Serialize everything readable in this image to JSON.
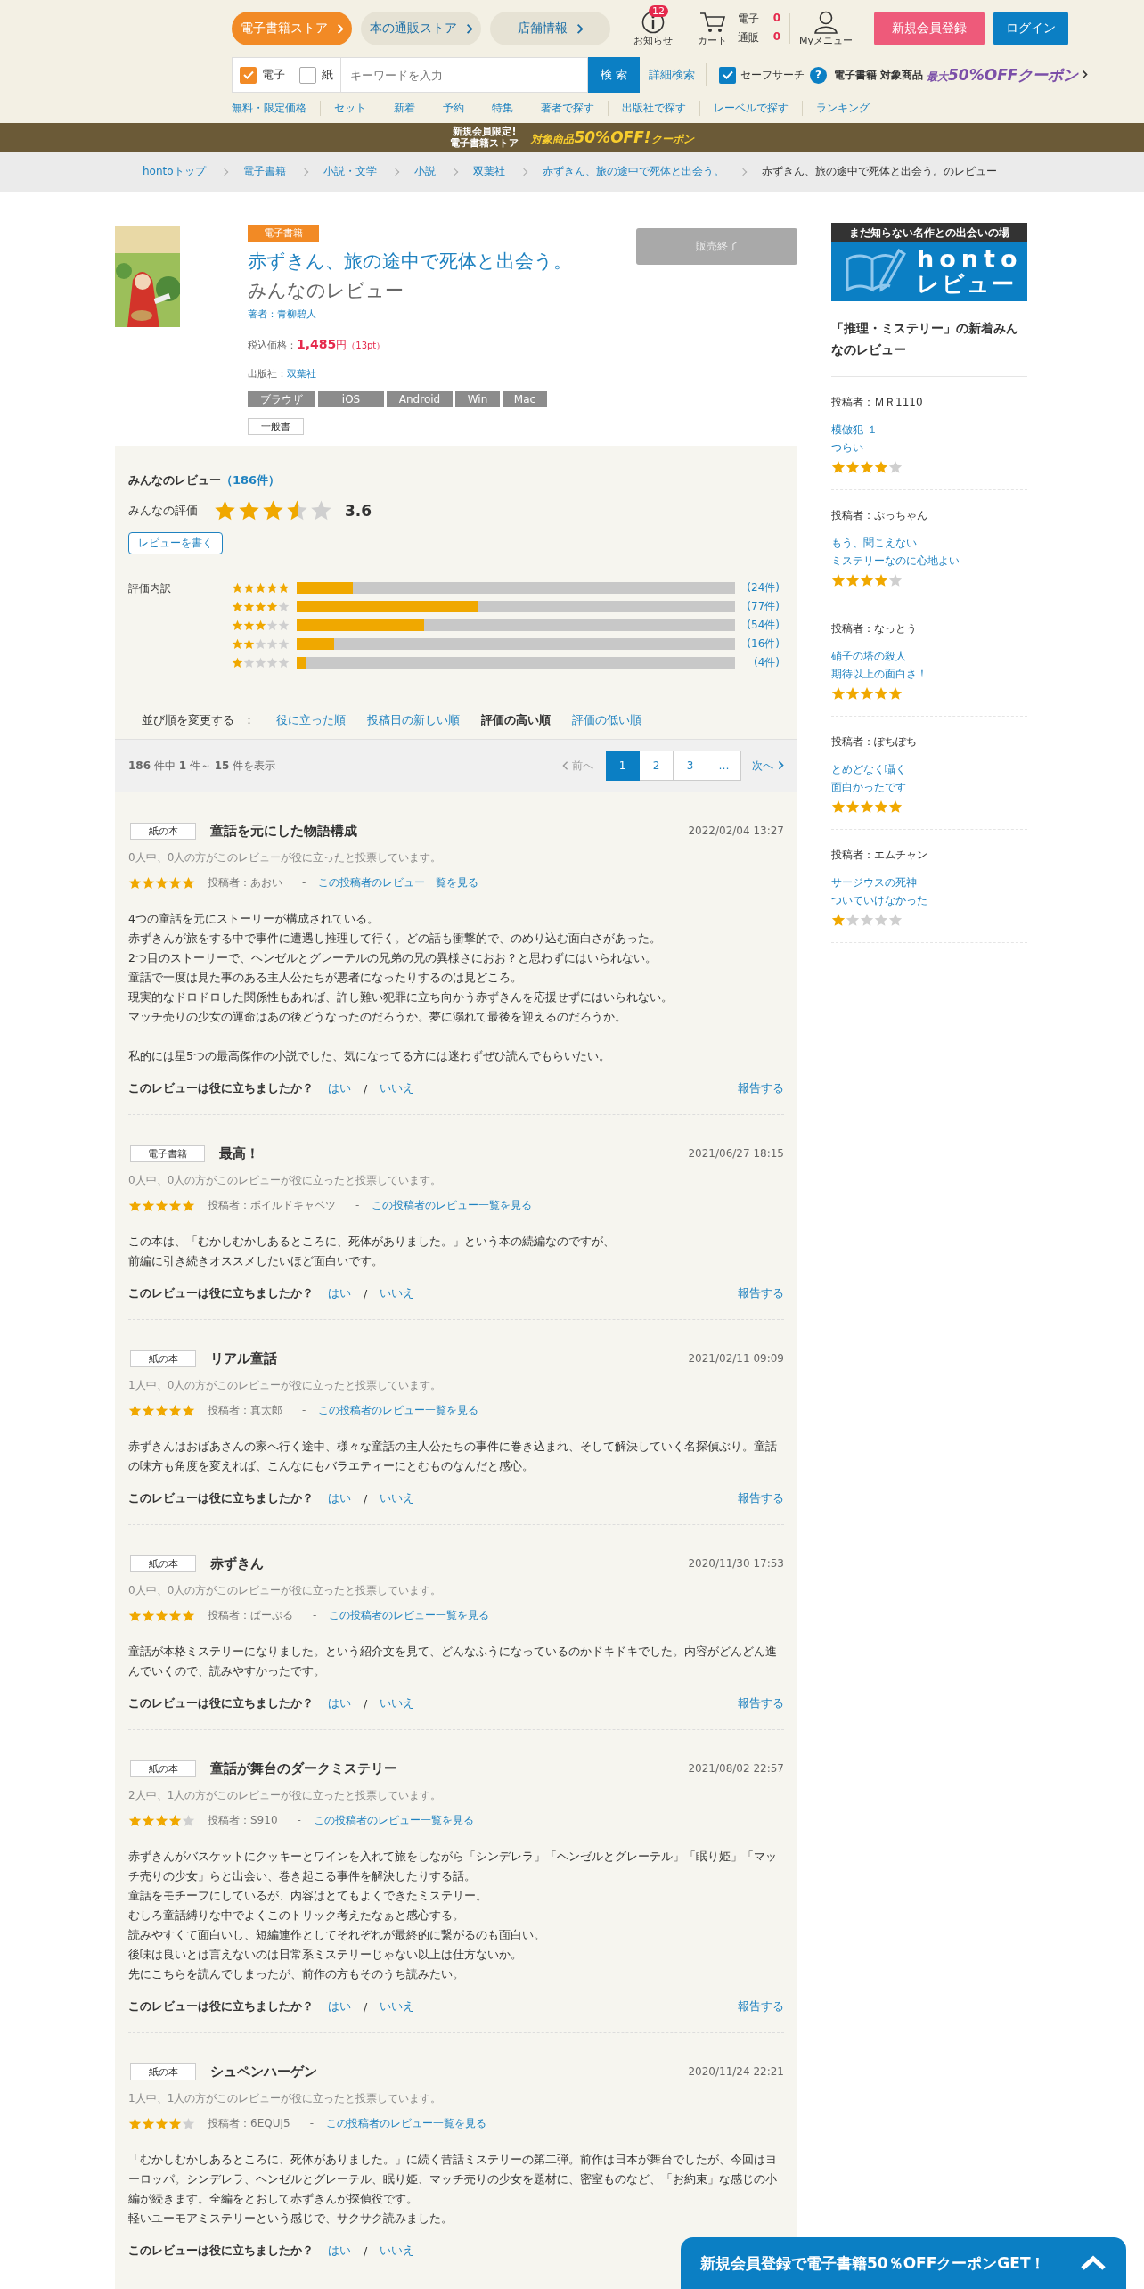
{
  "header": {
    "store_tabs": [
      {
        "label": "電子書籍ストア",
        "selected": true
      },
      {
        "label": "本の通販ストア",
        "selected": false
      },
      {
        "label": "店舗情報",
        "selected": false
      }
    ],
    "notifications": {
      "label": "お知らせ",
      "count": "12"
    },
    "cart": {
      "label": "カート",
      "rows": [
        {
          "label": "電子",
          "count": "0"
        },
        {
          "label": "通販",
          "count": "0"
        }
      ]
    },
    "my_menu": {
      "label": "Myメニュー"
    },
    "register_button": "新規会員登録",
    "login_button": "ログイン",
    "search": {
      "checkboxes": [
        {
          "label": "電子",
          "checked": true
        },
        {
          "label": "紙",
          "checked": false
        }
      ],
      "placeholder": "キーワードを入力",
      "button": "検 索",
      "advanced_link": "詳細検索",
      "safe_search": {
        "label": "セーフサーチ",
        "checked": true
      },
      "help": "?"
    },
    "coupon": {
      "prefix": "電子書籍",
      "middle": "対象商品",
      "offer": "最大**50%OFFクーポン**"
    },
    "nav_links": [
      "無料・限定価格",
      "セット",
      "新着",
      "予約",
      "特集",
      "著者で探す",
      "出版社で探す",
      "レーベルで探す",
      "ランキング"
    ]
  },
  "promo_banner": {
    "line1": "新規会員限定!",
    "line2": "電子書籍ストア",
    "offer": "対象商品**50%OFF!**クーポン"
  },
  "breadcrumb": [
    {
      "label": "hontoトップ",
      "current": false
    },
    {
      "label": "電子書籍",
      "current": false
    },
    {
      "label": "小説・文学",
      "current": false
    },
    {
      "label": "小説",
      "current": false
    },
    {
      "label": "双葉社",
      "current": false
    },
    {
      "label": "赤ずきん、旅の途中で死体と出会う。",
      "current": false
    },
    {
      "label": "赤ずきん、旅の途中で死体と出会う。のレビュー",
      "current": true
    }
  ],
  "product": {
    "format_badge": "電子書籍",
    "title": "赤ずきん、旅の途中で死体と出会う。",
    "title_suffix": "みんなのレビュー",
    "author": "著者：青柳碧人",
    "price_label": "税込価格：",
    "price": "1,485",
    "currency": "円",
    "points": "（13pt）",
    "publisher_label": "出版社：",
    "publisher": "双葉社",
    "platforms": [
      "ブラウザ",
      "iOS",
      "Android",
      "Win",
      "Mac"
    ],
    "genre": "一般書",
    "sold_out_button": {
      "label": "販売終了",
      "disabled": true
    }
  },
  "rating_summary": {
    "heading": "みんなのレビュー",
    "count": "（186件）",
    "average_label": "みんなの評価",
    "stars": 3.5,
    "score": "3.6",
    "write_button": "レビューを書く",
    "breakdown_label": "評価内訳",
    "breakdown": [
      {
        "stars": 5,
        "level": 0.129,
        "count": "(24件)"
      },
      {
        "stars": 4,
        "level": 0.414,
        "count": "(77件)"
      },
      {
        "stars": 3,
        "level": 0.29,
        "count": "(54件)"
      },
      {
        "stars": 2,
        "level": 0.086,
        "count": "(16件)"
      },
      {
        "stars": 1,
        "level": 0.022,
        "count": "(4件)"
      }
    ]
  },
  "sort": {
    "label": "並び順を変更する",
    "separator": "：",
    "options": [
      {
        "label": "役に立った順",
        "selected": false
      },
      {
        "label": "投稿日の新しい順",
        "selected": false
      },
      {
        "label": "評価の高い順",
        "selected": true
      },
      {
        "label": "評価の低い順",
        "selected": false
      }
    ]
  },
  "pagination": {
    "summary": "**186** 件中 **1** 件～ **15** 件を表示",
    "prev": "前へ",
    "pages": [
      {
        "label": "1",
        "selected": true
      },
      {
        "label": "2",
        "selected": false
      },
      {
        "label": "3",
        "selected": false
      },
      {
        "label": "…",
        "selected": false
      }
    ],
    "next": "次へ"
  },
  "reviews": [
    {
      "format": "紙の本",
      "title": "童話を元にした物語構成",
      "date": "2022/02/04 13:27",
      "votes": "0人中、0人の方がこのレビューが役に立ったと投票しています。",
      "stars": 5,
      "author": "投稿者：あおい",
      "separator": "-",
      "author_link": "この投稿者のレビュー一覧を見る",
      "paragraphs": [
        [
          "4つの童話を元にストーリーが構成されている。",
          "赤ずきんが旅をする中で事件に遭遇し推理して行く。どの話も衝撃的で、のめり込む面白さがあった。",
          "2つ目のストーリーで、ヘンゼルとグレーテルの兄弟の兄の異様さにおお？と思わずにはいられない。",
          "童話で一度は見た事のある主人公たちが悪者になったりするのは見どころ。",
          "現実的なドロドロした関係性もあれば、許し難い犯罪に立ち向かう赤ずきんを応援せずにはいられない。",
          "マッチ売りの少女の運命はあの後どうなったのだろうか。夢に溺れて最後を迎えるのだろうか。"
        ],
        [
          "私的には星5つの最高傑作の小説でした、気になってる方には迷わずぜひ読んでもらいたい。"
        ]
      ],
      "question": "このレビューは役に立ちましたか？",
      "yes": "はい",
      "slash": "/",
      "no": "いいえ",
      "report": "報告する"
    },
    {
      "format": "電子書籍",
      "title": "最高！",
      "date": "2021/06/27 18:15",
      "votes": "0人中、0人の方がこのレビューが役に立ったと投票しています。",
      "stars": 5,
      "author": "投稿者：ボイルドキャベツ",
      "separator": "-",
      "author_link": "この投稿者のレビュー一覧を見る",
      "paragraphs": [
        [
          "この本は、「むかしむかしあるところに、死体がありました。」という本の続編なのですが、",
          "前編に引き続きオススメしたいほど面白いです。"
        ]
      ],
      "question": "このレビューは役に立ちましたか？",
      "yes": "はい",
      "slash": "/",
      "no": "いいえ",
      "report": "報告する"
    },
    {
      "format": "紙の本",
      "title": "リアル童話",
      "date": "2021/02/11 09:09",
      "votes": "1人中、0人の方がこのレビューが役に立ったと投票しています。",
      "stars": 5,
      "author": "投稿者：真太郎",
      "separator": "-",
      "author_link": "この投稿者のレビュー一覧を見る",
      "paragraphs": [
        [
          "赤ずきんはおばあさんの家へ行く途中、様々な童話の主人公たちの事件に巻き込まれ、そして解決していく名探偵ぶり。童話の味方も角度を変えれば、こんなにもバラエティーにとむものなんだと感心。"
        ]
      ],
      "question": "このレビューは役に立ちましたか？",
      "yes": "はい",
      "slash": "/",
      "no": "いいえ",
      "report": "報告する"
    },
    {
      "format": "紙の本",
      "title": "赤ずきん",
      "date": "2020/11/30 17:53",
      "votes": "0人中、0人の方がこのレビューが役に立ったと投票しています。",
      "stars": 5,
      "author": "投稿者：ぱーぷる",
      "separator": "-",
      "author_link": "この投稿者のレビュー一覧を見る",
      "paragraphs": [
        [
          "童話が本格ミステリーになりました。という紹介文を見て、どんなふうになっているのかドキドキでした。内容がどんどん進んでいくので、読みやすかったです。"
        ]
      ],
      "question": "このレビューは役に立ちましたか？",
      "yes": "はい",
      "slash": "/",
      "no": "いいえ",
      "report": "報告する"
    },
    {
      "format": "紙の本",
      "title": "童話が舞台のダークミステリー",
      "date": "2021/08/02 22:57",
      "votes": "2人中、1人の方がこのレビューが役に立ったと投票しています。",
      "stars": 4,
      "author": "投稿者：S910",
      "separator": "-",
      "author_link": "この投稿者のレビュー一覧を見る",
      "paragraphs": [
        [
          "赤ずきんがバスケットにクッキーとワインを入れて旅をしながら「シンデレラ」「ヘンゼルとグレーテル」「眠り姫」「マッチ売りの少女」らと出会い、巻き起こる事件を解決したりする話。",
          "童話をモチーフにしているが、内容はとてもよくできたミステリー。",
          "むしろ童話縛りな中でよくこのトリック考えたなぁと感心する。",
          "読みやすくて面白いし、短編連作としてそれぞれが最終的に繋がるのも面白い。",
          "後味は良いとは言えないのは日常系ミステリーじゃない以上は仕方ないか。",
          "先にこちらを読んでしまったが、前作の方もそのうち読みたい。"
        ]
      ],
      "question": "このレビューは役に立ちましたか？",
      "yes": "はい",
      "slash": "/",
      "no": "いいえ",
      "report": "報告する"
    },
    {
      "format": "紙の本",
      "title": "シュペンハーゲン",
      "date": "2020/11/24 22:21",
      "votes": "1人中、1人の方がこのレビューが役に立ったと投票しています。",
      "stars": 4,
      "author": "投稿者：6EQUJ5",
      "separator": "-",
      "author_link": "この投稿者のレビュー一覧を見る",
      "paragraphs": [
        [
          "「むかしむかしあるところに、死体がありました。」に続く昔話ミステリーの第二弾。前作は日本が舞台でしたが、今回はヨーロッパ。シンデレラ、ヘンゼルとグレーテル、眠り姫、マッチ売りの少女を題材に、密室ものなど、「お約束」な感じの小編が続きます。全編をとおして赤ずきんが探偵役です。",
          "軽いユーモアミステリーという感じで、サクサク読みました。"
        ]
      ],
      "question": "このレビューは役に立ちましたか？",
      "yes": "はい",
      "slash": "/",
      "no": "いいえ"
    }
  ],
  "sidebar": {
    "banner": {
      "tagline": "まだ知らない名作との出会いの場",
      "logo": "honto",
      "logo_sub": "レビュー"
    },
    "heading": "「推理・ミステリー」の新着みんなのレビュー",
    "items": [
      {
        "author": "投稿者：ＭＲ1110",
        "book": "模倣犯 １",
        "review_title": "つらい",
        "stars": 4
      },
      {
        "author": "投稿者：ぷっちゃん",
        "book": "もう、聞こえない",
        "review_title": "ミステリーなのに心地よい",
        "stars": 4
      },
      {
        "author": "投稿者：なっとう",
        "book": "硝子の塔の殺人",
        "review_title": "期待以上の面白さ！",
        "stars": 5
      },
      {
        "author": "投稿者：ぽちぽち",
        "book": "とめどなく囁く",
        "review_title": "面白かったです",
        "stars": 5
      },
      {
        "author": "投稿者：エムチャン",
        "book": "サージウスの死神",
        "review_title": "ついていけなかった",
        "stars": 1
      }
    ]
  },
  "floating_banner": {
    "text": "新規会員登録で電子書籍50％OFFクーポンGET！"
  }
}
